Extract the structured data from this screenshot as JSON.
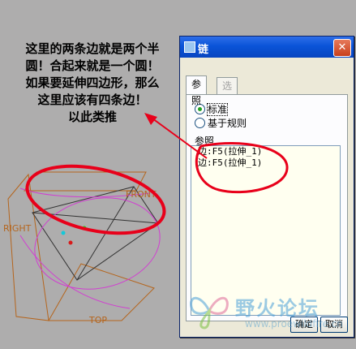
{
  "annotation": {
    "lines": [
      "这里的两条边就是两个半",
      "圆！合起来就是一个圆！",
      "如果要延伸四边形，那么",
      "这里应该有四条边！",
      "以此类推"
    ]
  },
  "viewport": {
    "labels": {
      "front": "FRONT",
      "right": "RIGHT",
      "top": "TOP"
    }
  },
  "dialog": {
    "title": "链",
    "close_label": "✕",
    "tabs": [
      {
        "label": "参照",
        "active": true
      },
      {
        "label": "选项",
        "active": false
      }
    ],
    "radios": [
      {
        "label": "标准",
        "checked": true
      },
      {
        "label": "基于规则",
        "checked": false
      }
    ],
    "refs_label": "参照",
    "refs": [
      "边:F5(拉伸_1)",
      "边:F5(拉伸_1)"
    ],
    "ok_label": "确定",
    "cancel_label": "取消"
  },
  "watermark": {
    "text": "野火论坛",
    "url": "www.proewildfire.cn"
  },
  "colors": {
    "background": "#aeadad",
    "annotation_red": "#e8001a",
    "title_bar": "#0a54d8",
    "datum_plane": "#b5651d",
    "sketch_magenta": "#d13fd1"
  }
}
